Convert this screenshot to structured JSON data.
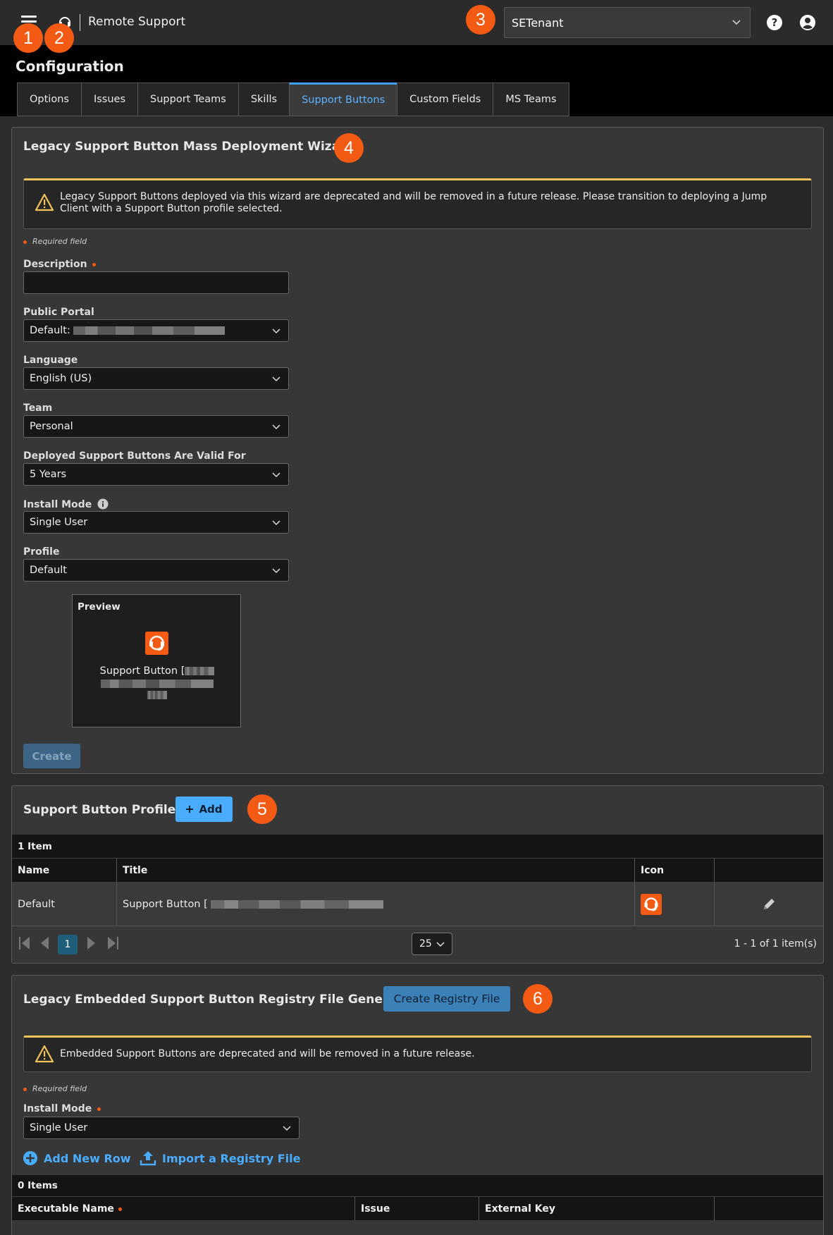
{
  "header": {
    "app_title": "Remote Support",
    "tenant": "SETenant",
    "icons": [
      "menu-icon",
      "headset-icon",
      "chevron-down-icon",
      "help-icon",
      "user-icon"
    ]
  },
  "badges": [
    "1",
    "2",
    "3",
    "4",
    "5",
    "6"
  ],
  "page_title": "Configuration",
  "tabs": [
    "Options",
    "Issues",
    "Support Teams",
    "Skills",
    "Support Buttons",
    "Custom Fields",
    "MS Teams"
  ],
  "active_tab": "Support Buttons",
  "wizard": {
    "title": "Legacy Support Button Mass Deployment Wizard",
    "alert": "Legacy Support Buttons deployed via this wizard are deprecated and will be removed in a future release. Please transition to deploying a Jump Client with a Support Button profile selected.",
    "required_note": "Required field",
    "description_label": "Description",
    "description_value": "",
    "portal_label": "Public Portal",
    "portal_value": "Default:",
    "language_label": "Language",
    "language_value": "English (US)",
    "team_label": "Team",
    "team_value": "Personal",
    "valid_label": "Deployed Support Buttons Are Valid For",
    "valid_value": "5 Years",
    "install_label": "Install Mode",
    "install_value": "Single User",
    "profile_label": "Profile",
    "profile_value": "Default",
    "preview_label": "Preview",
    "preview_text": "Support Button [",
    "create_label": "Create"
  },
  "profiles": {
    "title": "Support Button Profiles",
    "add_label": "Add",
    "count": "1 Item",
    "columns": [
      "Name",
      "Title",
      "Icon",
      ""
    ],
    "rows": [
      {
        "name": "Default",
        "title": "Support Button ["
      }
    ],
    "pager": {
      "current_page": "1",
      "page_size": "25",
      "info": "1 - 1 of 1 item(s)"
    }
  },
  "registry": {
    "title": "Legacy Embedded Support Button Registry File Generator",
    "create_label": "Create Registry File",
    "alert": "Embedded Support Buttons are deprecated and will be removed in a future release.",
    "required_note": "Required field",
    "install_label": "Install Mode",
    "install_value": "Single User",
    "add_row_label": "Add New Row",
    "import_label": "Import a Registry File",
    "count": "0 Items",
    "columns": [
      "Executable Name",
      "Issue",
      "External Key",
      ""
    ]
  },
  "colors": {
    "accent": "#4aacff",
    "badge": "#f35b14",
    "warning": "#f0c35a",
    "background": "#2c2c2c"
  }
}
